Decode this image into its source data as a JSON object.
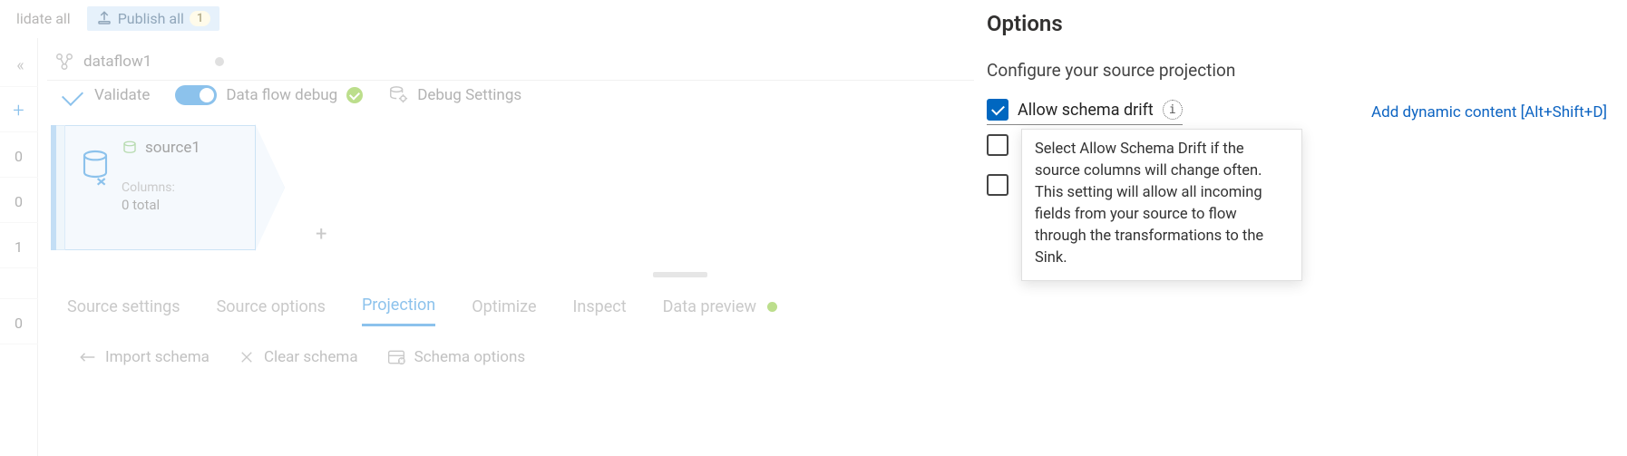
{
  "topbar": {
    "validate_all": "lidate all",
    "publish_label": "Publish all",
    "publish_count": "1"
  },
  "leftrail": {
    "counts": [
      "0",
      "0",
      "1",
      "0"
    ]
  },
  "tab": {
    "name": "dataflow1"
  },
  "actionbar": {
    "validate": "Validate",
    "debug_label": "Data flow debug",
    "debug_settings": "Debug Settings"
  },
  "node": {
    "name": "source1",
    "columns_label": "Columns:",
    "columns_value": "0 total"
  },
  "lowertabs": {
    "t0": "Source settings",
    "t1": "Source options",
    "t2": "Projection",
    "t3": "Optimize",
    "t4": "Inspect",
    "t5": "Data preview"
  },
  "schemaactions": {
    "import": "Import schema",
    "clear": "Clear schema",
    "options": "Schema options"
  },
  "options": {
    "title": "Options",
    "subtitle": "Configure your source projection",
    "allow_schema_drift": "Allow schema drift",
    "dynamic_link": "Add dynamic content [Alt+Shift+D]",
    "tooltip": "Select Allow Schema Drift if the source columns will change often. This setting will allow all incoming fields from your source to flow through the transformations to the Sink."
  }
}
